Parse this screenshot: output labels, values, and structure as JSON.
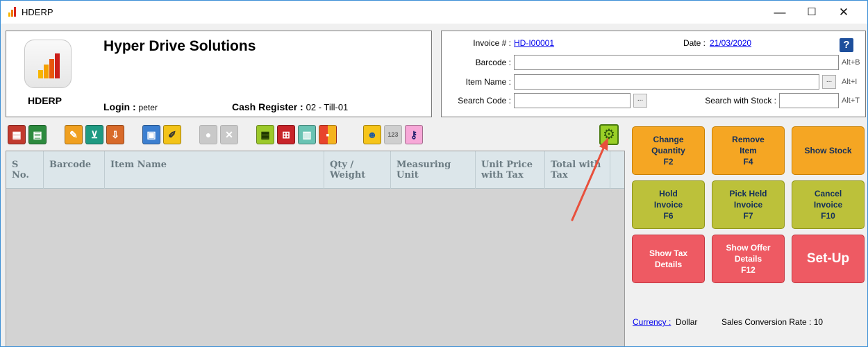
{
  "window": {
    "title": "HDERP",
    "minimize": "—",
    "maximize": "☐",
    "close": "✕"
  },
  "company": {
    "logo_text": "HDERP",
    "name": "Hyper Drive Solutions",
    "login_label": "Login :",
    "login_value": "peter",
    "register_label": "Cash Register :",
    "register_value": "02 - Till-01"
  },
  "invoice": {
    "invoice_label": "Invoice # :",
    "invoice_value": "HD-I00001",
    "date_label": "Date :",
    "date_value": "21/03/2020",
    "help": "?",
    "barcode_label": "Barcode :",
    "barcode_shortcut": "Alt+B",
    "item_name_label": "Item Name :",
    "item_name_shortcut": "Alt+I",
    "search_code_label": "Search Code :",
    "search_stock_label": "Search with Stock :",
    "search_stock_shortcut": "Alt+T",
    "ellipsis": "..."
  },
  "toolbar": {
    "icons": [
      "report-icon",
      "export-report-icon",
      "edit-note-icon",
      "cart-icon",
      "download-icon",
      "card-icon",
      "edit-icon",
      "disabled-badge-icon",
      "disabled-cancel-icon",
      "calculator-icon",
      "tax-keypad-icon",
      "rate-calculator-icon",
      "color-tiles-icon",
      "user-icon",
      "counter-display-icon",
      "key-icon"
    ],
    "settings_icon": "gear-icon"
  },
  "grid": {
    "columns": [
      "S\nNo.",
      "Barcode",
      "Item Name",
      "Qty /\nWeight",
      "Measuring\nUnit",
      "Unit Price\nwith Tax",
      "Total with\nTax"
    ]
  },
  "actions": {
    "change_quantity": "Change\nQuantity\nF2",
    "remove_item": "Remove\nItem\nF4",
    "show_stock": "Show Stock",
    "hold_invoice": "Hold\nInvoice\nF6",
    "pick_held_invoice": "Pick Held\nInvoice\nF7",
    "cancel_invoice": "Cancel\nInvoice\nF10",
    "show_tax_details": "Show Tax\nDetails",
    "show_offer_details": "Show Offer\nDetails\nF12",
    "set_up": "Set-Up"
  },
  "footer": {
    "currency_label": "Currency :",
    "currency_value": "Dollar",
    "rate_label": "Sales Conversion Rate :",
    "rate_value": "10"
  },
  "colors": {
    "orange": "#f5a623",
    "olive": "#bcc13a",
    "red": "#ee5a63",
    "annotation_arrow": "#e8503c"
  }
}
